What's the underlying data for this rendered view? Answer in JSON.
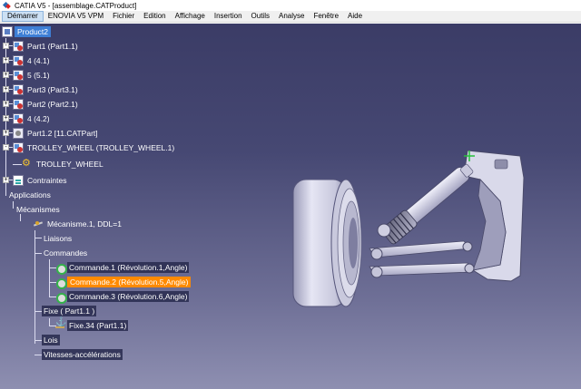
{
  "window": {
    "title": "CATIA V5 - [assemblage.CATProduct]"
  },
  "menu": [
    {
      "label": "Démarrer",
      "active": true
    },
    {
      "label": "ENOVIA V5 VPM"
    },
    {
      "label": "Fichier"
    },
    {
      "label": "Edition"
    },
    {
      "label": "Affichage"
    },
    {
      "label": "Insertion"
    },
    {
      "label": "Outils"
    },
    {
      "label": "Analyse"
    },
    {
      "label": "Fenêtre"
    },
    {
      "label": "Aide"
    }
  ],
  "tree": {
    "root": "Product2",
    "nodes": [
      {
        "label": "Part1 (Part1.1)",
        "icon": "part-icon"
      },
      {
        "label": "4 (4.1)",
        "icon": "part-icon"
      },
      {
        "label": "5 (5.1)",
        "icon": "part-icon"
      },
      {
        "label": "Part3 (Part3.1)",
        "icon": "part-icon"
      },
      {
        "label": "Part2 (Part2.1)",
        "icon": "part-icon"
      },
      {
        "label": "4 (4.2)",
        "icon": "part-icon"
      },
      {
        "label": "Part1.2 [11.CATPart]",
        "icon": "gear-part-icon"
      },
      {
        "label": "TROLLEY_WHEEL (TROLLEY_WHEEL.1)",
        "icon": "part-icon"
      },
      {
        "label": "TROLLEY_WHEEL",
        "icon": "gear-icon"
      },
      {
        "label": "Contraintes",
        "icon": "constraints-icon"
      }
    ],
    "applications": "Applications",
    "mecanismes": "Mécanismes",
    "mecanisme": "Mécanisme.1, DDL=1",
    "liaisons": "Liaisons",
    "commandes": "Commandes",
    "commande_items": [
      {
        "label": "Commande.1 (Révolution.1,Angle)",
        "selected": false
      },
      {
        "label": "Commande.2 (Révolution.5,Angle)",
        "selected": true
      },
      {
        "label": "Commande.3 (Révolution.6,Angle)",
        "selected": false
      }
    ],
    "fixe": "Fixe ( Part1.1 )",
    "fixe_item": "Fixe.34 (Part1.1)",
    "lois": "Lois",
    "vitesses": "Vitesses-accélérations"
  },
  "colors": {
    "background_top": "#3b3c66",
    "background_bottom": "#8e8fb1",
    "selection_blue": "#3e7fd6",
    "selection_orange": "#ff8a00"
  }
}
